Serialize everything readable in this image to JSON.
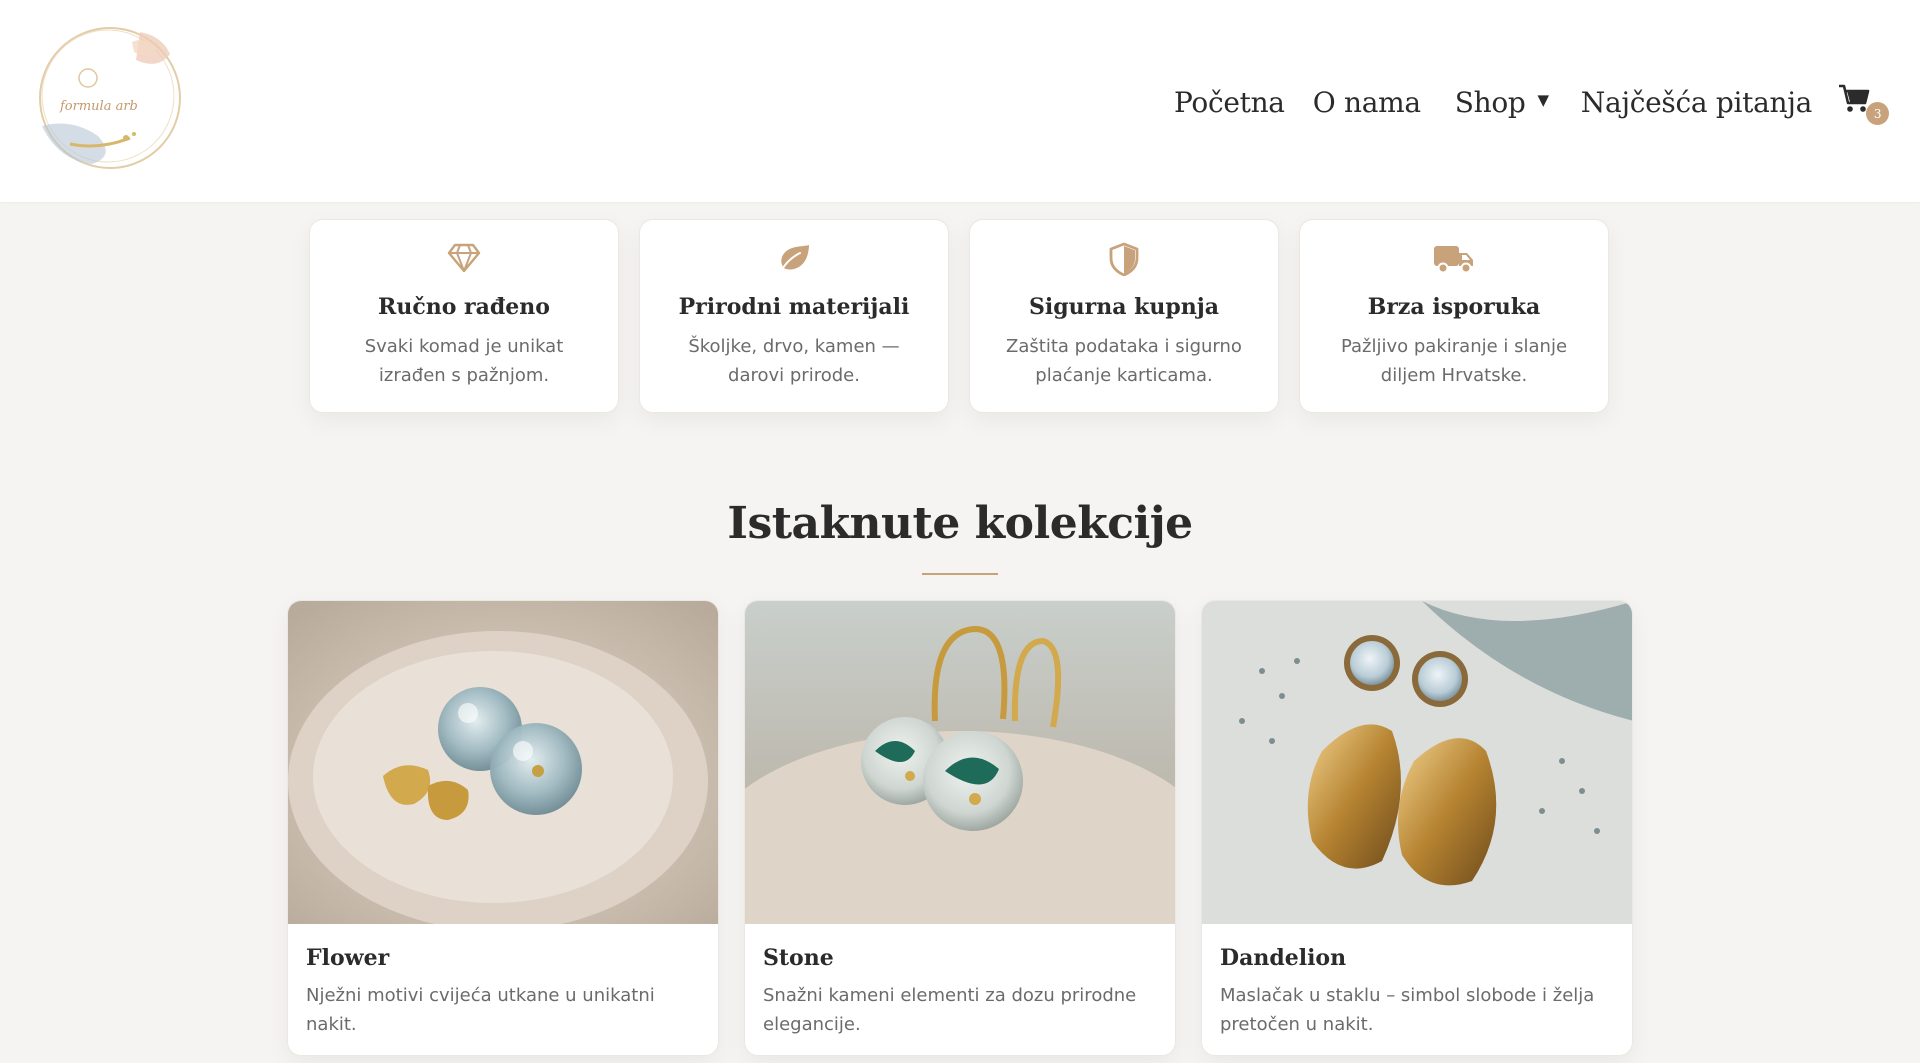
{
  "header": {
    "logo_text": "formula arb",
    "nav": [
      "Početna",
      "O nama",
      "Shop",
      "Najčešća pitanja"
    ],
    "cart_count": "3"
  },
  "features": [
    {
      "icon": "diamond-icon",
      "title": "Ručno rađeno",
      "text": "Svaki komad je unikat izrađen s pažnjom."
    },
    {
      "icon": "leaf-icon",
      "title": "Prirodni materijali",
      "text": "Školjke, drvo, kamen — darovi prirode."
    },
    {
      "icon": "shield-icon",
      "title": "Sigurna kupnja",
      "text": "Zaštita podataka i sigurno plaćanje karticama."
    },
    {
      "icon": "truck-icon",
      "title": "Brza isporuka",
      "text": "Pažljivo pakiranje i slanje diljem Hrvatske."
    }
  ],
  "section": {
    "title": "Istaknute kolekcije"
  },
  "collections": [
    {
      "title": "Flower",
      "text": "Nježni motivi cvijeća utkane u unikatni nakit."
    },
    {
      "title": "Stone",
      "text": "Snažni kameni elementi za dozu prirodne elegancije."
    },
    {
      "title": "Dandelion",
      "text": "Maslačak u staklu – simbol slobode i želja pretočen u nakit."
    }
  ],
  "colors": {
    "accent": "#c8a27a",
    "text": "#2b2b2b",
    "muted": "#6b6b6b",
    "background": "#f5f4f2"
  }
}
